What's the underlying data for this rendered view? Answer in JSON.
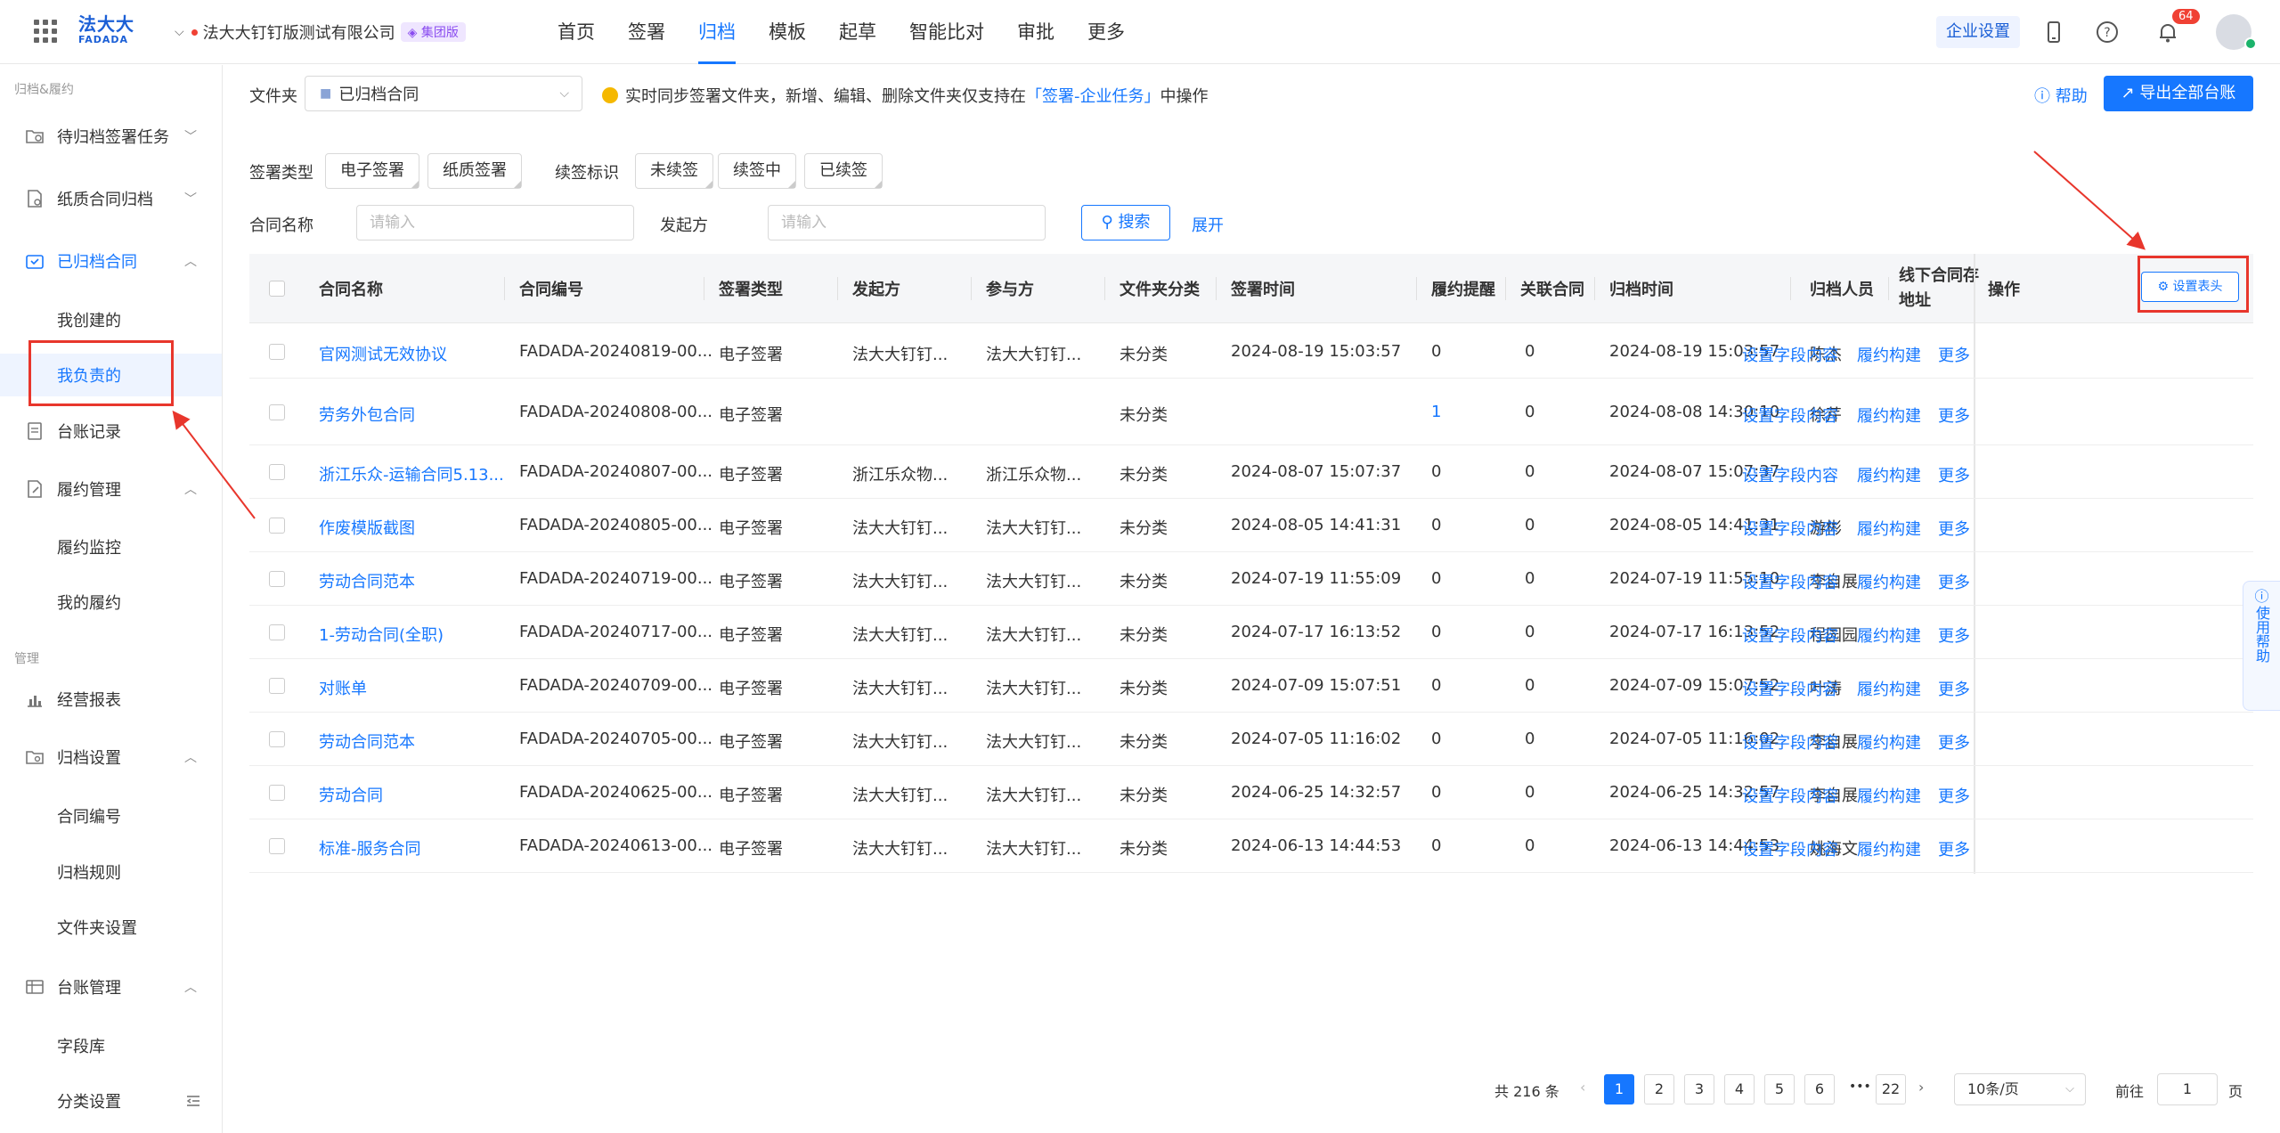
{
  "topbar": {
    "logo_line1": "法大大",
    "logo_line2": "FADADA",
    "company": "法大大钉钉版测试有限公司",
    "company_badge": "集团版",
    "nav": [
      "首页",
      "签署",
      "归档",
      "模板",
      "起草",
      "智能比对",
      "审批",
      "更多"
    ],
    "active_nav": "归档",
    "enterprise_settings": "企业设置",
    "notification_count": "64"
  },
  "sidebar": {
    "group1": "归档&履约",
    "group2": "管理",
    "items": [
      {
        "label": "待归档签署任务",
        "icon": "folder-clock-icon",
        "arrow": "﹀"
      },
      {
        "label": "纸质合同归档",
        "icon": "paper-doc-icon",
        "arrow": "﹀"
      },
      {
        "label": "已归档合同",
        "icon": "archive-box-icon",
        "arrow": "︿"
      },
      {
        "label": "我创建的"
      },
      {
        "label": "我负责的"
      },
      {
        "label": "台账记录",
        "icon": "ledger-icon"
      },
      {
        "label": "履约管理",
        "icon": "contract-edit-icon",
        "arrow": "︿"
      },
      {
        "label": "履约监控"
      },
      {
        "label": "我的履约"
      },
      {
        "label": "经营报表",
        "icon": "bar-chart-icon"
      },
      {
        "label": "归档设置",
        "icon": "folder-settings-icon",
        "arrow": "︿"
      },
      {
        "label": "合同编号"
      },
      {
        "label": "归档规则"
      },
      {
        "label": "文件夹设置"
      },
      {
        "label": "台账管理",
        "icon": "table-icon",
        "arrow": "︿"
      },
      {
        "label": "字段库"
      },
      {
        "label": "分类设置"
      }
    ]
  },
  "toolbar": {
    "folder_label": "文件夹",
    "folder_value": "已归档合同",
    "notice_prefix": "实时同步签署文件夹，新增、编辑、删除文件夹仅支持在",
    "notice_link": "「签署-企业任务」",
    "notice_suffix": "中操作",
    "help": "帮助",
    "export": "导出全部台账"
  },
  "filters": {
    "sign_type_label": "签署类型",
    "sign_types": [
      "电子签署",
      "纸质签署"
    ],
    "renew_label": "续签标识",
    "renew_options": [
      "未续签",
      "续签中",
      "已续签"
    ],
    "contract_name_label": "合同名称",
    "contract_name_placeholder": "请输入",
    "initiator_label": "发起方",
    "initiator_placeholder": "请输入",
    "search": "搜索",
    "expand": "展开"
  },
  "table": {
    "columns": [
      "合同名称",
      "合同编号",
      "签署类型",
      "发起方",
      "参与方",
      "文件夹分类",
      "签署时间",
      "履约提醒",
      "关联合同",
      "归档时间",
      "归档人员",
      "线下合同存",
      "地址",
      "操作"
    ],
    "set_header": "设置表头",
    "actions": [
      "设置字段内容",
      "履约构建",
      "更多"
    ],
    "rows": [
      {
        "name": "官网测试无效协议",
        "no": "FADADA-20240819-00...",
        "type": "电子签署",
        "initiator": "法大大钉钉...",
        "party": "法大大钉钉...",
        "folder": "未分类",
        "sign_time": "2024-08-19 15:03:57",
        "remind": "0",
        "related": "0",
        "archive_time": "2024-08-19 15:03:57",
        "person": "陈杰"
      },
      {
        "name": "劳务外包合同",
        "no": "FADADA-20240808-00...",
        "type": "电子签署",
        "initiator": "",
        "party": "",
        "folder": "未分类",
        "sign_time": "",
        "remind": "1",
        "related": "0",
        "archive_time": "2024-08-08 14:30:10",
        "person": "徐芹"
      },
      {
        "name": "浙江乐众-运输合同5.13...",
        "no": "FADADA-20240807-00...",
        "type": "电子签署",
        "initiator": "浙江乐众物...",
        "party": "浙江乐众物...",
        "folder": "未分类",
        "sign_time": "2024-08-07 15:07:37",
        "remind": "0",
        "related": "0",
        "archive_time": "2024-08-07 15:07:37",
        "person": ""
      },
      {
        "name": "作废模版截图",
        "no": "FADADA-20240805-00...",
        "type": "电子签署",
        "initiator": "法大大钉钉...",
        "party": "法大大钉钉...",
        "folder": "未分类",
        "sign_time": "2024-08-05 14:41:31",
        "remind": "0",
        "related": "0",
        "archive_time": "2024-08-05 14:41:31",
        "person": "游彬"
      },
      {
        "name": "劳动合同范本",
        "no": "FADADA-20240719-00...",
        "type": "电子签署",
        "initiator": "法大大钉钉...",
        "party": "法大大钉钉...",
        "folder": "未分类",
        "sign_time": "2024-07-19 11:55:09",
        "remind": "0",
        "related": "0",
        "archive_time": "2024-07-19 11:55:10",
        "person": "李自展"
      },
      {
        "name": "1-劳动合同(全职)",
        "no": "FADADA-20240717-00...",
        "type": "电子签署",
        "initiator": "法大大钉钉...",
        "party": "法大大钉钉...",
        "folder": "未分类",
        "sign_time": "2024-07-17 16:13:52",
        "remind": "0",
        "related": "0",
        "archive_time": "2024-07-17 16:13:52",
        "person": "程园园"
      },
      {
        "name": "对账单",
        "no": "FADADA-20240709-00...",
        "type": "电子签署",
        "initiator": "法大大钉钉...",
        "party": "法大大钉钉...",
        "folder": "未分类",
        "sign_time": "2024-07-09 15:07:51",
        "remind": "0",
        "related": "0",
        "archive_time": "2024-07-09 15:07:52",
        "person": "叶涛"
      },
      {
        "name": "劳动合同范本",
        "no": "FADADA-20240705-00...",
        "type": "电子签署",
        "initiator": "法大大钉钉...",
        "party": "法大大钉钉...",
        "folder": "未分类",
        "sign_time": "2024-07-05 11:16:02",
        "remind": "0",
        "related": "0",
        "archive_time": "2024-07-05 11:16:02",
        "person": "李自展"
      },
      {
        "name": "劳动合同",
        "no": "FADADA-20240625-00...",
        "type": "电子签署",
        "initiator": "法大大钉钉...",
        "party": "法大大钉钉...",
        "folder": "未分类",
        "sign_time": "2024-06-25 14:32:57",
        "remind": "0",
        "related": "0",
        "archive_time": "2024-06-25 14:32:57",
        "person": "李自展"
      },
      {
        "name": "标准-服务合同",
        "no": "FADADA-20240613-00...",
        "type": "电子签署",
        "initiator": "法大大钉钉...",
        "party": "法大大钉钉...",
        "folder": "未分类",
        "sign_time": "2024-06-13 14:44:53",
        "remind": "0",
        "related": "0",
        "archive_time": "2024-06-13 14:44:53",
        "person": "姚海文"
      }
    ]
  },
  "pagination": {
    "total": "共 216 条",
    "pages": [
      "1",
      "2",
      "3",
      "4",
      "5",
      "6"
    ],
    "ellipsis": "•••",
    "last": "22",
    "page_size": "10条/页",
    "goto_label": "前往",
    "goto_value": "1",
    "goto_suffix": "页"
  },
  "side_help": "使用帮助"
}
